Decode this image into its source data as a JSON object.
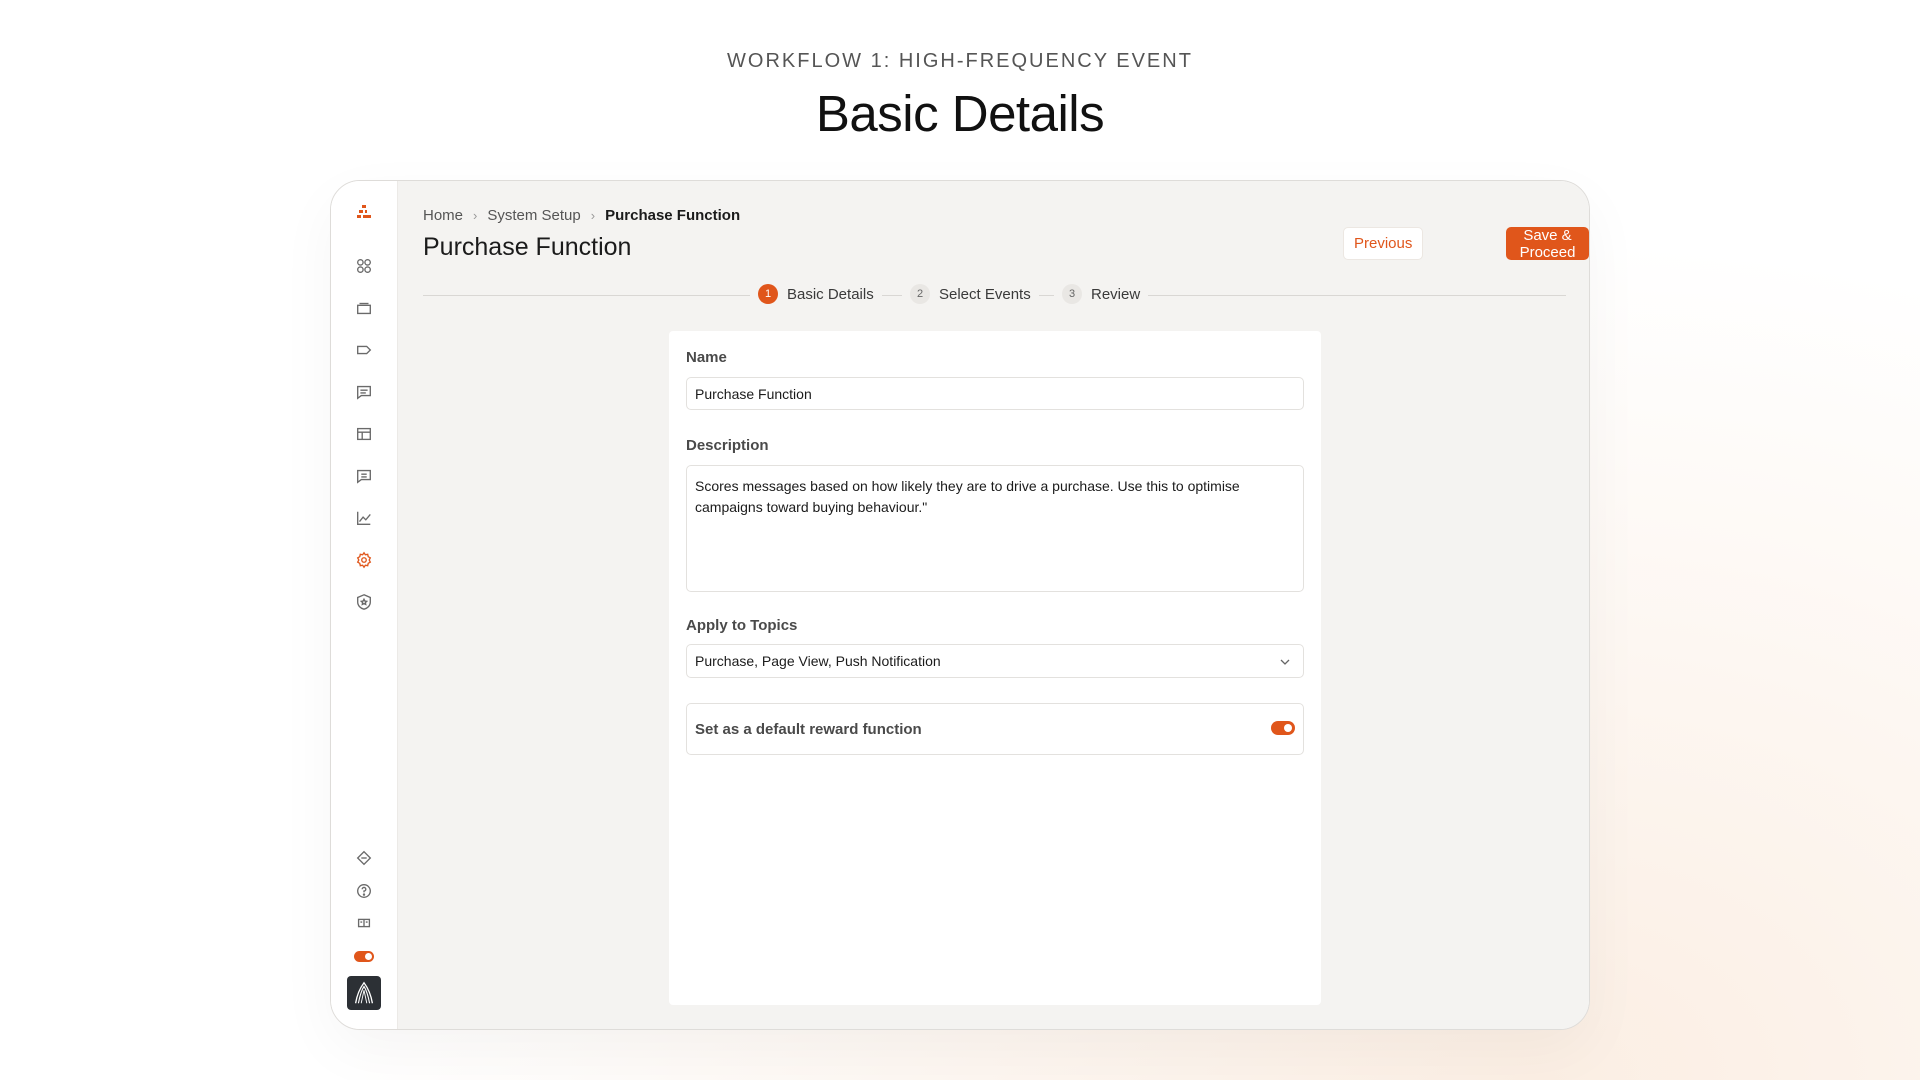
{
  "hero": {
    "eyebrow": "WORKFLOW 1: HIGH-FREQUENCY EVENT",
    "title": "Basic Details"
  },
  "sidebar": {
    "items": [
      {
        "icon": "logo-icon"
      },
      {
        "icon": "apps-grid-icon"
      },
      {
        "icon": "folder-icon"
      },
      {
        "icon": "tag-icon"
      },
      {
        "icon": "message-icon"
      },
      {
        "icon": "layout-icon"
      },
      {
        "icon": "chat-list-icon"
      },
      {
        "icon": "chart-line-icon"
      },
      {
        "icon": "settings-icon",
        "active": true
      },
      {
        "icon": "shield-star-icon"
      }
    ],
    "bottom": [
      {
        "icon": "diamond-icon"
      },
      {
        "icon": "help-icon"
      },
      {
        "icon": "book-icon"
      },
      {
        "icon": "toggle-icon"
      },
      {
        "icon": "avatar"
      }
    ]
  },
  "breadcrumb": {
    "home": "Home",
    "section": "System Setup",
    "current": "Purchase Function"
  },
  "page": {
    "title": "Purchase Function"
  },
  "actions": {
    "previous": "Previous",
    "save": "Save & Proceed"
  },
  "stepper": {
    "steps": [
      {
        "num": "1",
        "label": "Basic Details",
        "active": true
      },
      {
        "num": "2",
        "label": "Select Events",
        "active": false
      },
      {
        "num": "3",
        "label": "Review",
        "active": false
      }
    ]
  },
  "form": {
    "name_label": "Name",
    "name_value": "Purchase Function",
    "description_label": "Description",
    "description_value": "Scores messages based on how likely they are to drive a purchase. Use this to optimise campaigns toward buying behaviour.\"",
    "topics_label": "Apply to Topics",
    "topics_value": "Purchase, Page View, Push Notification",
    "default_label": "Set as a default reward function",
    "default_on": true
  },
  "colors": {
    "accent": "#e0561b",
    "background": "#f4f3f1"
  }
}
